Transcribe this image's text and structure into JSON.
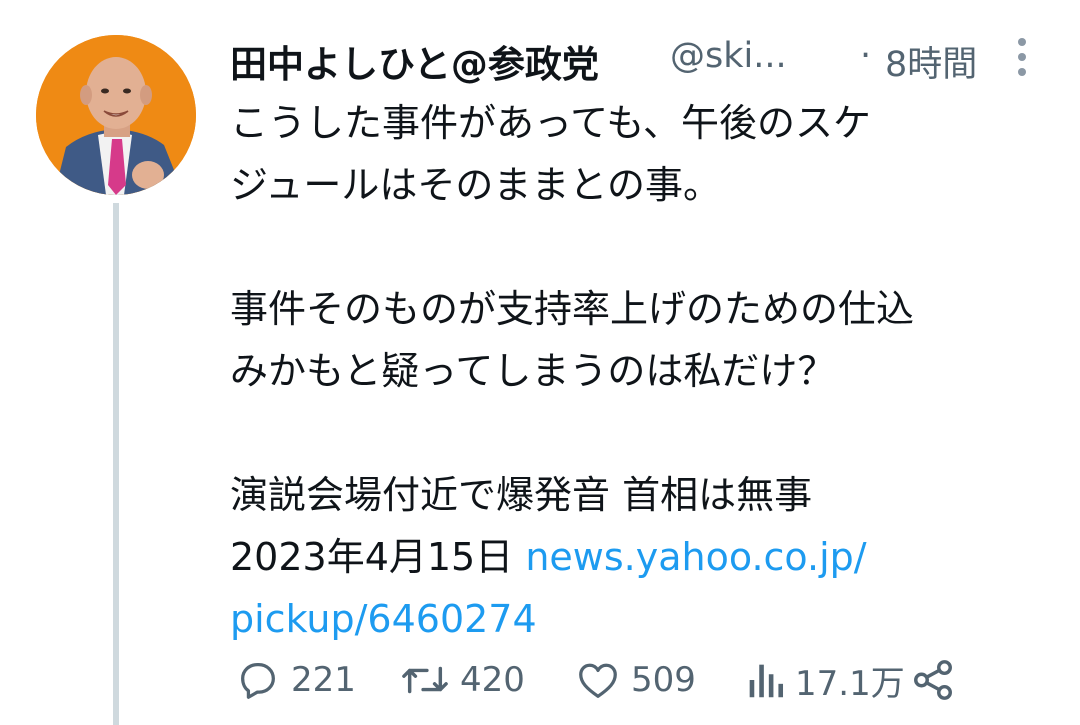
{
  "author": {
    "display_name": "田中よしひと@参政党",
    "handle": "@ski...",
    "separator": "·",
    "time": "8時間",
    "avatar_bg": "#ef8a14"
  },
  "tweet": {
    "paragraph1": [
      "こうした事件があっても、午後のスケ",
      "ジュールはそのままとの事。"
    ],
    "paragraph2": [
      "事件そのものが支持率上げのための仕込",
      "みかもと疑ってしまうのは私だけ？"
    ],
    "news_title": "演説会場付近で爆発音 首相は無事",
    "news_date": "2023年4月15日",
    "link_part1": "news.yahoo.co.jp/",
    "link_part2": "pickup/6460274",
    "link_color": "#1d9bf0"
  },
  "actions": {
    "reply": {
      "icon": "reply-icon",
      "count": "221"
    },
    "retweet": {
      "icon": "retweet-icon",
      "count": "420"
    },
    "like": {
      "icon": "heart-icon",
      "count": "509"
    },
    "views": {
      "icon": "views-icon",
      "count": "17.1万"
    },
    "share": {
      "icon": "share-icon"
    }
  }
}
